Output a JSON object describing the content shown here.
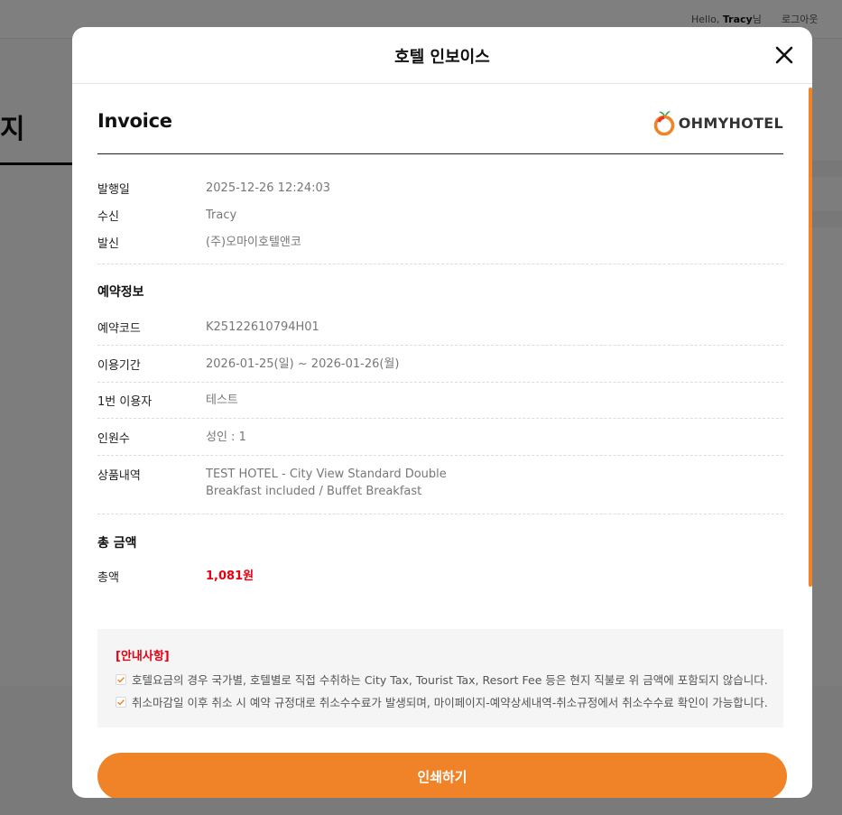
{
  "background": {
    "greeting_prefix": "Hello,",
    "greeting_name": "Tracy",
    "greeting_suffix": "님",
    "logout_label": "로그아웃",
    "page_title_partial": "지"
  },
  "modal": {
    "title": "호텔 인보이스",
    "invoice_heading": "Invoice",
    "brand_name": "OHMYHOTEL",
    "meta": [
      {
        "label": "발행일",
        "value": "2025-12-26 12:24:03"
      },
      {
        "label": "수신",
        "value": "Tracy"
      },
      {
        "label": "발신",
        "value": "(주)오마이호텔앤코"
      }
    ],
    "reservation": {
      "heading": "예약정보",
      "rows": [
        {
          "label": "예약코드",
          "value": "K25122610794H01"
        },
        {
          "label": "이용기간",
          "value": "2026-01-25(일) ~ 2026-01-26(월)"
        },
        {
          "label": "1번 이용자",
          "value": "테스트"
        },
        {
          "label": "인원수",
          "value": "성인 : 1"
        },
        {
          "label": "상품내역",
          "value_line1": "TEST HOTEL - City View Standard Double",
          "value_line2": "Breakfast included / Buffet Breakfast"
        }
      ]
    },
    "total": {
      "heading": "총 금액",
      "label": "총액",
      "value": "1,081원"
    },
    "notice": {
      "title": "[안내사항]",
      "items": [
        "호텔요금의 경우 국가별, 호텔별로 직접 수취하는 City Tax, Tourist Tax, Resort Fee 등은 현지 직불로 위 금액에 포함되지 않습니다.",
        "취소마감일 이후 취소 시 예약 규정대로 취소수수료가 발생되며, 마이페이지-예약상세내역-취소규정에서 취소수수료 확인이 가능합니다."
      ]
    },
    "print_label": "인쇄하기"
  },
  "colors": {
    "accent": "#f08228",
    "price": "#e60012",
    "overlay": "rgba(0,0,0,0.5)"
  },
  "icons": {
    "close": "close-icon",
    "check": "check-icon",
    "logo": "ohmyhotel-logo"
  }
}
